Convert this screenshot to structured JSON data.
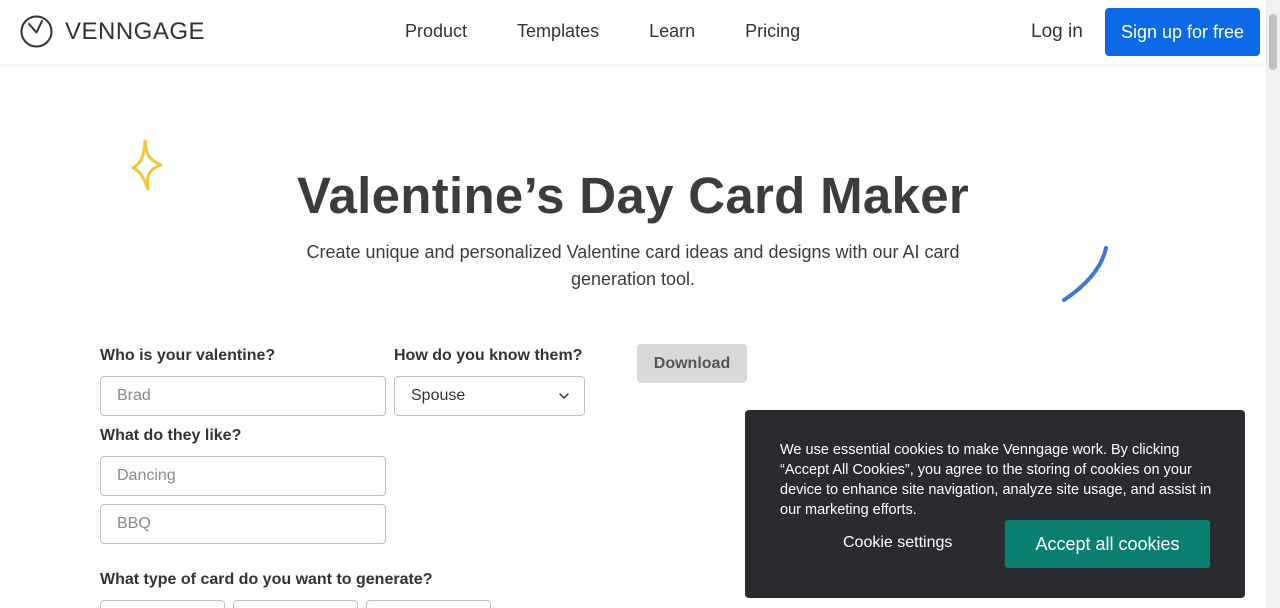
{
  "header": {
    "logo_text": "VENNGAGE",
    "nav": [
      "Product",
      "Templates",
      "Learn",
      "Pricing"
    ],
    "login_label": "Log in",
    "signup_label": "Sign up for free"
  },
  "hero": {
    "title": "Valentine’s Day Card Maker",
    "subtitle": "Create unique and personalized Valentine card ideas and designs with our AI card generation tool."
  },
  "form": {
    "valentine_label": "Who is your valentine?",
    "valentine_placeholder": "Brad",
    "relation_label": "How do you know them?",
    "relation_value": "Spouse",
    "likes_label": "What do they like?",
    "likes_placeholder_1": "Dancing",
    "likes_placeholder_2": "BBQ",
    "card_type_label": "What type of card do you want to generate?",
    "download_label": "Download"
  },
  "cookie": {
    "text": "We use essential cookies to make Venngage work. By clicking “Accept All Cookies”, you agree to the storing of cookies on your device to enhance site navigation, analyze site usage, and assist in our marketing efforts.",
    "settings_label": "Cookie settings",
    "accept_label": "Accept all cookies"
  },
  "colors": {
    "brand_blue": "#0c6ae6",
    "accept_green": "#0b8071",
    "banner_bg": "#2a2a31"
  }
}
